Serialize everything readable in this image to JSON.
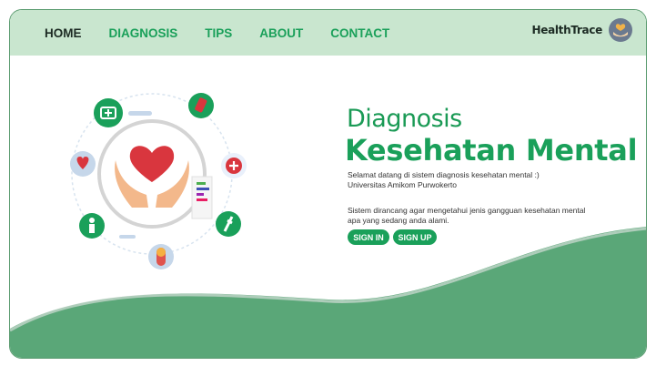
{
  "nav": {
    "items": [
      "HOME",
      "DIAGNOSIS",
      "TIPS",
      "ABOUT",
      "CONTACT"
    ]
  },
  "brand": {
    "name": "HealthTrace"
  },
  "hero": {
    "title": "Diagnosis",
    "subtitle": "Kesehatan Mental",
    "intro_line1": "Selamat datang di sistem diagnosis kesehatan mental :)",
    "intro_line2": "Universitas Amikom Purwokerto",
    "desc_line1": "Sistem dirancang agar mengetahui jenis gangguan  kesehatan mental",
    "desc_line2": "apa yang sedang anda alami.",
    "signin_label": "SIGN IN",
    "signup_label": "SIGN UP"
  },
  "colors": {
    "accent": "#1aa05a",
    "nav_bg": "#c9e6cf",
    "wave": "#5aa778"
  },
  "icons": [
    "heart-hands-icon",
    "first-aid-kit-icon",
    "pill-bottle-icon",
    "plus-icon",
    "syringe-icon",
    "capsule-icon",
    "person-icon",
    "heartbeat-icon",
    "logo-hands-heart-icon"
  ]
}
